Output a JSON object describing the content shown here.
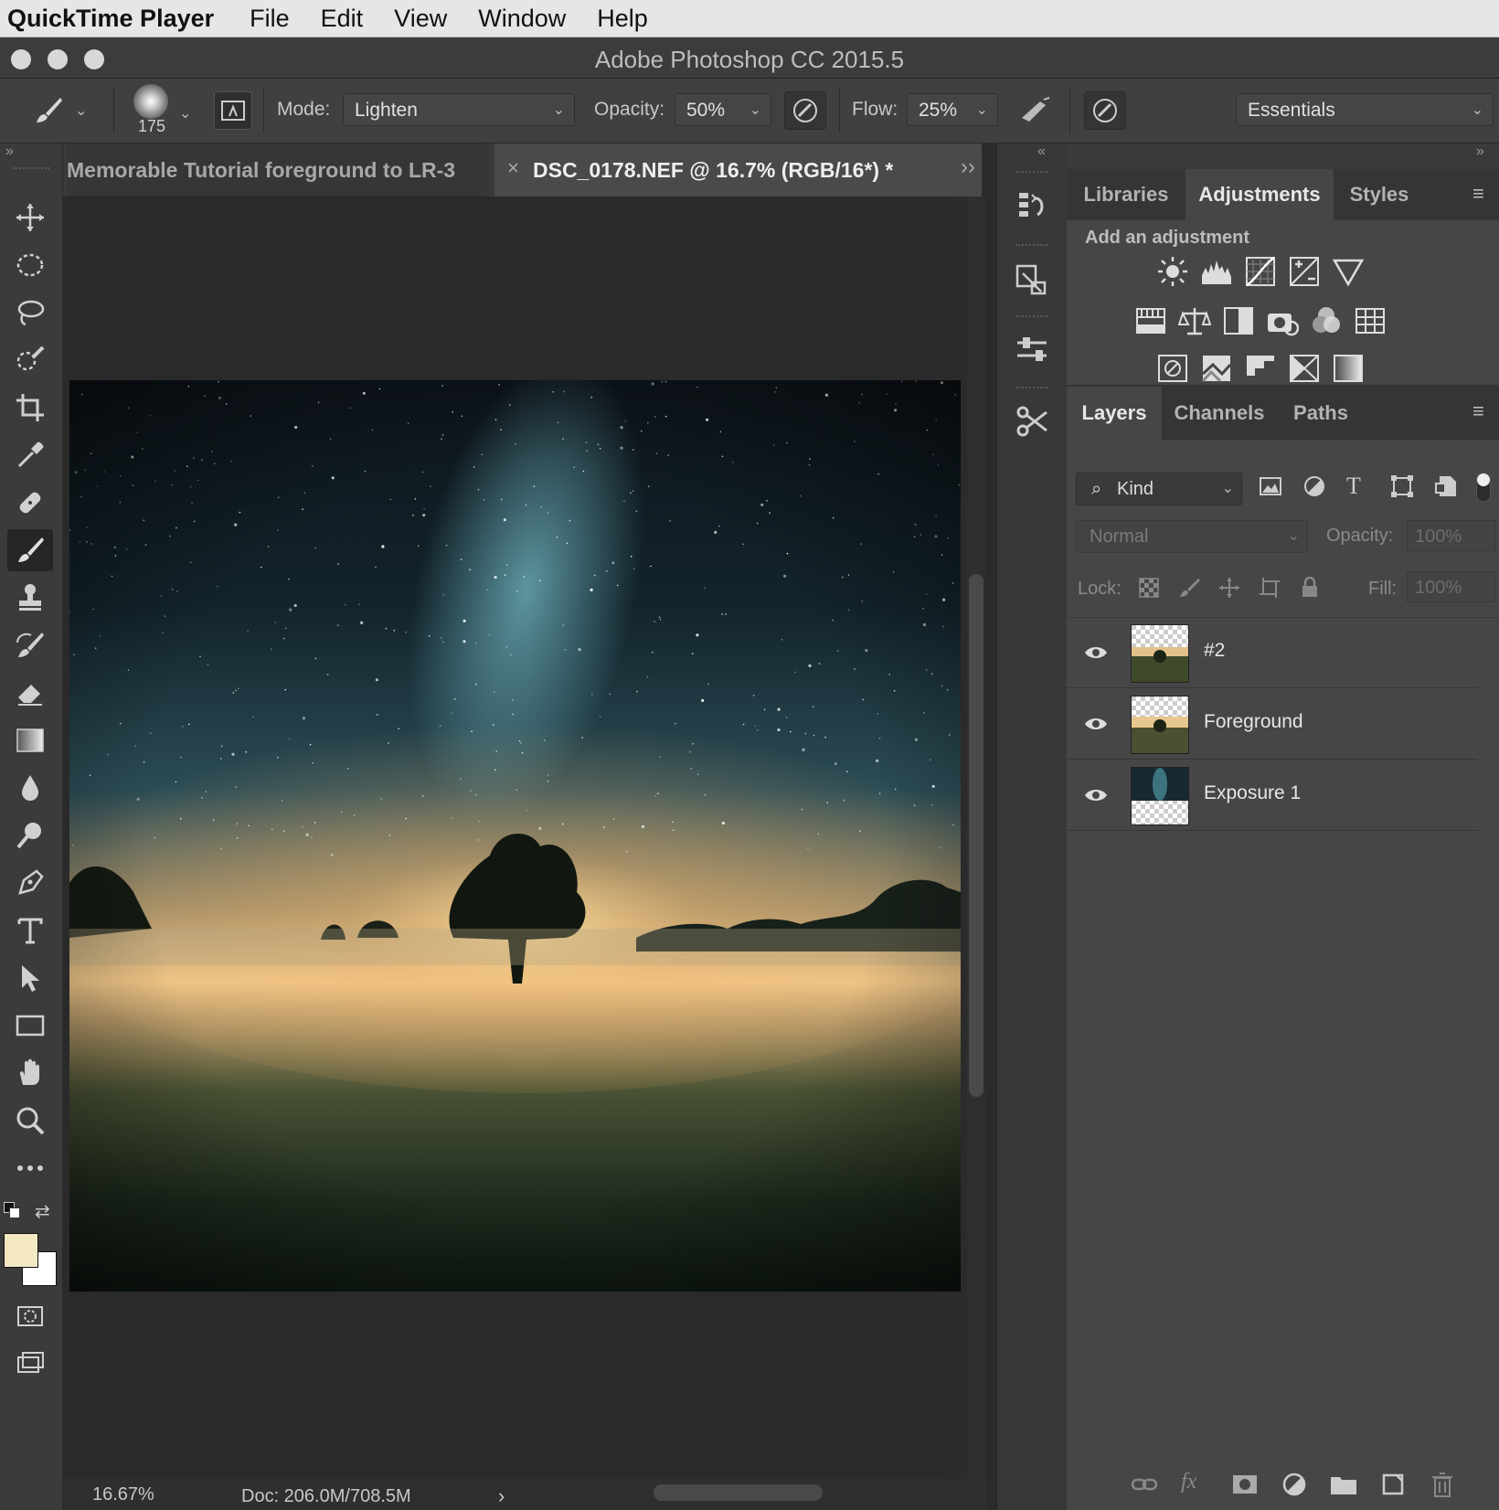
{
  "menubar": {
    "app_name": "QuickTime Player",
    "items": [
      "File",
      "Edit",
      "View",
      "Window",
      "Help"
    ]
  },
  "window": {
    "title": "Adobe Photoshop CC 2015.5"
  },
  "options_bar": {
    "brush_size": "175",
    "mode_label": "Mode:",
    "mode_value": "Lighten",
    "opacity_label": "Opacity:",
    "opacity_value": "50%",
    "flow_label": "Flow:",
    "flow_value": "25%",
    "workspace": "Essentials"
  },
  "document_tabs": [
    {
      "label": "Memorable Tutorial foreground to LR-3",
      "active": false
    },
    {
      "label": "DSC_0178.NEF @ 16.7% (RGB/16*) *",
      "active": true
    }
  ],
  "tab_close": "×",
  "tabs_overflow": "››",
  "status": {
    "zoom": "16.67%",
    "doc": "Doc: 206.0M/708.5M",
    "arrow": "›"
  },
  "adjustments_panel": {
    "tabs": [
      "Libraries",
      "Adjustments",
      "Styles"
    ],
    "active_tab": "Adjustments",
    "heading": "Add an adjustment",
    "icons_row1": [
      "brightness-contrast-icon",
      "levels-icon",
      "curves-icon",
      "exposure-icon",
      "vibrance-icon"
    ],
    "icons_row2": [
      "hue-saturation-icon",
      "color-balance-icon",
      "black-white-icon",
      "photo-filter-icon",
      "channel-mixer-icon",
      "color-lookup-icon"
    ],
    "icons_row3": [
      "invert-icon",
      "posterize-icon",
      "threshold-icon",
      "selective-color-icon",
      "gradient-map-icon"
    ]
  },
  "layers_panel": {
    "tabs": [
      "Layers",
      "Channels",
      "Paths"
    ],
    "active_tab": "Layers",
    "filter_value": "Kind",
    "blend_mode": "Normal",
    "opacity_label": "Opacity:",
    "opacity_value": "100%",
    "lock_label": "Lock:",
    "fill_label": "Fill:",
    "fill_value": "100%",
    "layers": [
      {
        "name": "#2",
        "visible": true
      },
      {
        "name": "Foreground",
        "visible": true
      },
      {
        "name": "Exposure 1",
        "visible": true
      }
    ]
  },
  "colors": {
    "foreground_swatch": "#f4e8c2",
    "background_swatch": "#ffffff",
    "accent_sky": "#5fa7b5",
    "accent_glow": "#f0c27a"
  },
  "tools": [
    "move-tool",
    "marquee-tool",
    "lasso-tool",
    "quick-selection-tool",
    "crop-tool",
    "eyedropper-tool",
    "healing-brush-tool",
    "brush-tool",
    "clone-stamp-tool",
    "history-brush-tool",
    "eraser-tool",
    "gradient-tool",
    "blur-tool",
    "dodge-tool",
    "pen-tool",
    "type-tool",
    "path-selection-tool",
    "rectangle-tool",
    "hand-tool",
    "zoom-tool",
    "more-tools"
  ],
  "active_tool": "brush-tool"
}
